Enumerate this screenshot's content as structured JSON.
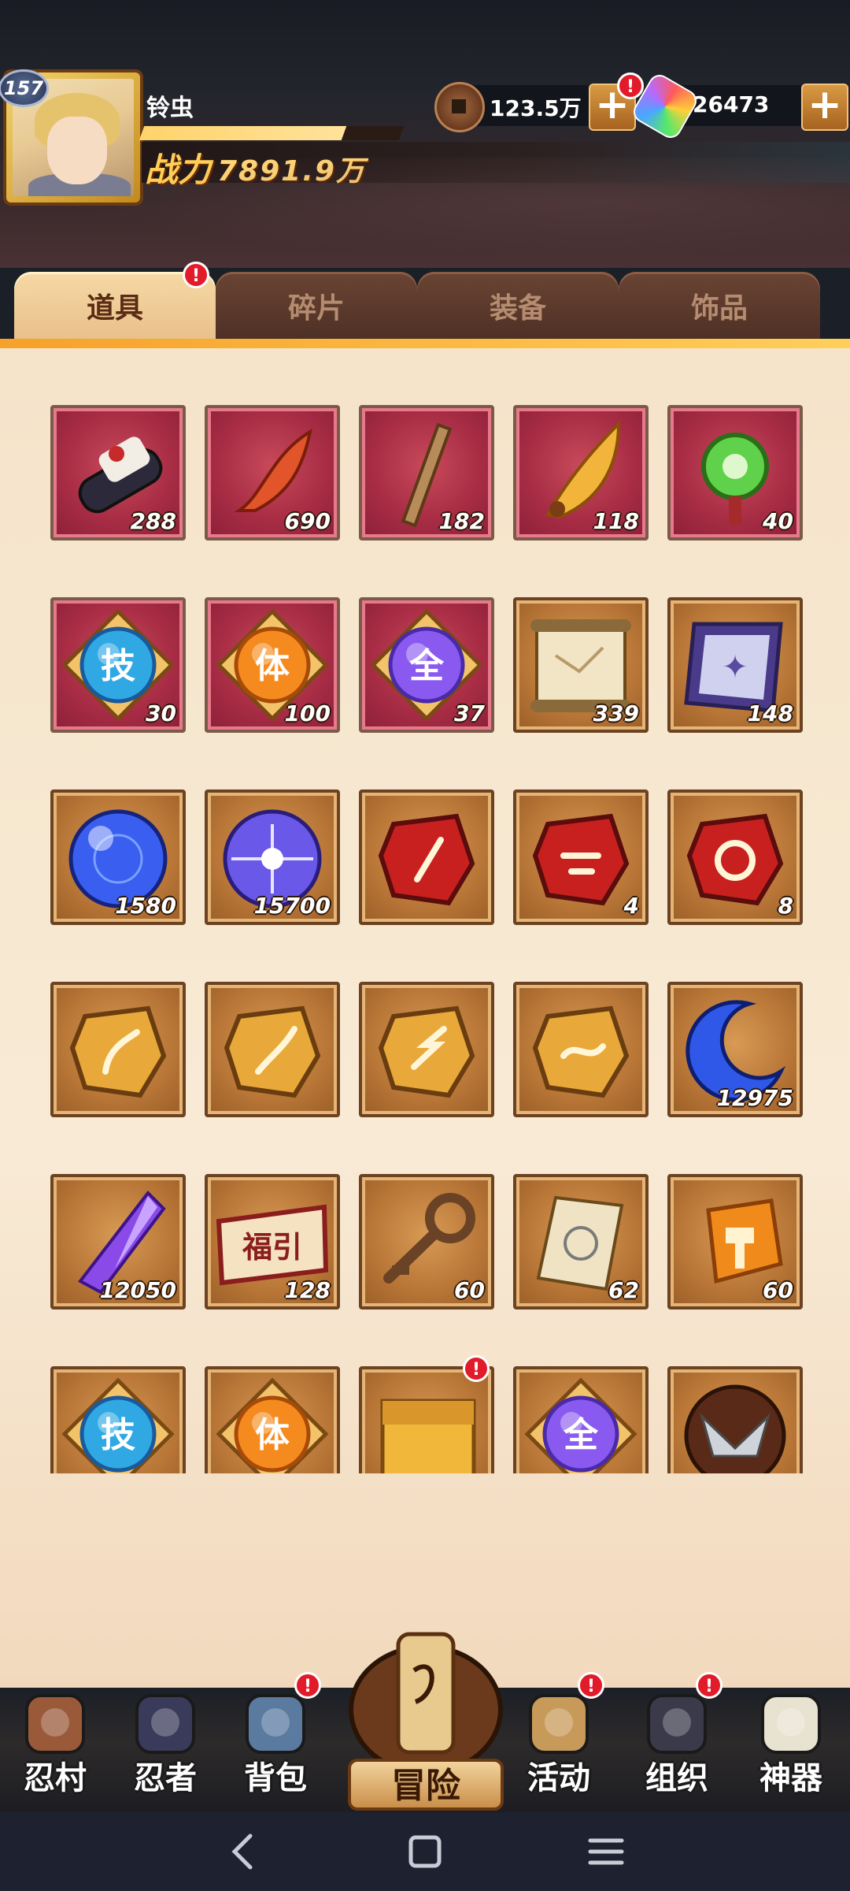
{
  "header": {
    "level": "157",
    "player_name": "铃虫",
    "exp_fraction": 0.78,
    "power_label": "战力",
    "power_value": "7891.9万",
    "copper": "123.5万",
    "gems": "26473",
    "plus": "+",
    "alert": "!"
  },
  "tabs": [
    {
      "label": "道具",
      "active": true
    },
    {
      "label": "碎片",
      "active": false
    },
    {
      "label": "装备",
      "active": false
    },
    {
      "label": "饰品",
      "active": false
    }
  ],
  "items": [
    {
      "icon": "scroll-bundle-icon",
      "count": "288",
      "bg": "red"
    },
    {
      "icon": "red-feather-icon",
      "count": "690",
      "bg": "red"
    },
    {
      "icon": "wooden-stick-icon",
      "count": "182",
      "bg": "red"
    },
    {
      "icon": "gold-feather-icon",
      "count": "118",
      "bg": "red"
    },
    {
      "icon": "jade-charm-icon",
      "count": "40",
      "bg": "red"
    },
    {
      "icon": "skill-orb-icon",
      "glyph": "技",
      "count": "30",
      "bg": "red"
    },
    {
      "icon": "body-orb-icon",
      "glyph": "体",
      "count": "100",
      "bg": "red"
    },
    {
      "icon": "all-orb-icon",
      "glyph": "全",
      "count": "37",
      "bg": "red"
    },
    {
      "icon": "map-scroll-icon",
      "count": "339",
      "bg": "brown"
    },
    {
      "icon": "purple-banner-icon",
      "count": "148",
      "bg": "brown"
    },
    {
      "icon": "blue-orb-icon",
      "count": "1580",
      "bg": "brown"
    },
    {
      "icon": "purple-orb-icon",
      "count": "15700",
      "bg": "brown"
    },
    {
      "icon": "red-rune-brush-icon",
      "count": "",
      "bg": "brown"
    },
    {
      "icon": "red-rune-fist-icon",
      "count": "4",
      "bg": "brown"
    },
    {
      "icon": "red-rune-target-icon",
      "count": "8",
      "bg": "brown"
    },
    {
      "icon": "gold-rune-horn-icon",
      "count": "",
      "bg": "brown"
    },
    {
      "icon": "gold-rune-flame-icon",
      "count": "",
      "bg": "brown"
    },
    {
      "icon": "gold-rune-bolt-icon",
      "count": "",
      "bg": "brown"
    },
    {
      "icon": "gold-rune-wave-icon",
      "count": "",
      "bg": "brown"
    },
    {
      "icon": "blue-moon-icon",
      "count": "12975",
      "bg": "brown"
    },
    {
      "icon": "purple-crystal-icon",
      "count": "12050",
      "bg": "brown"
    },
    {
      "icon": "fortune-ticket-icon",
      "glyph": "福引",
      "count": "128",
      "bg": "brown"
    },
    {
      "icon": "bronze-key-icon",
      "count": "60",
      "bg": "brown"
    },
    {
      "icon": "seal-paper-icon",
      "count": "62",
      "bg": "brown"
    },
    {
      "icon": "amber-hammer-icon",
      "count": "60",
      "bg": "brown"
    },
    {
      "icon": "skill-orb-icon",
      "glyph": "技",
      "count": "",
      "bg": "brown"
    },
    {
      "icon": "body-orb-icon",
      "glyph": "体",
      "count": "",
      "bg": "brown"
    },
    {
      "icon": "gold-chest-icon",
      "count": "",
      "bg": "brown",
      "alert": true
    },
    {
      "icon": "all-orb-icon",
      "glyph": "全",
      "count": "",
      "bg": "brown"
    },
    {
      "icon": "winged-emblem-icon",
      "count": "",
      "bg": "brown"
    }
  ],
  "nav": [
    {
      "label": "忍村",
      "icon": "village-gate-icon"
    },
    {
      "label": "忍者",
      "icon": "ninja-head-icon"
    },
    {
      "label": "背包",
      "icon": "backpack-icon",
      "alert": true
    },
    {
      "label": "冒险",
      "icon": "adventure-scroll-icon"
    },
    {
      "label": "活动",
      "icon": "drum-icon",
      "alert": true
    },
    {
      "label": "组织",
      "icon": "organization-icon",
      "alert": true
    },
    {
      "label": "神器",
      "icon": "artifact-scroll-icon"
    }
  ],
  "colors": {
    "accent": "#f6a12a",
    "alert": "#e21b2a",
    "tab_active": "#f6d9a5"
  }
}
